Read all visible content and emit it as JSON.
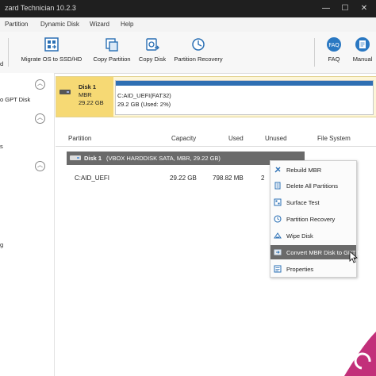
{
  "window": {
    "title": "zard Technician 10.2.3",
    "min": "—",
    "max": "☐",
    "close": "✕"
  },
  "menu": {
    "items": [
      "Partition",
      "Dynamic Disk",
      "Wizard",
      "Help"
    ]
  },
  "toolbar": {
    "items": [
      {
        "label": "Migrate OS to SSD/HD",
        "icon": "migrate-os-icon"
      },
      {
        "label": "Copy Partition",
        "icon": "copy-partition-icon"
      },
      {
        "label": "Copy Disk",
        "icon": "copy-disk-icon"
      },
      {
        "label": "Partition Recovery",
        "icon": "partition-recovery-icon"
      },
      {
        "label": "FAQ",
        "icon": "faq-icon"
      },
      {
        "label": "Manual",
        "icon": "manual-icon"
      }
    ],
    "left_fragment": "d"
  },
  "sidebar": {
    "item_fragment": "o GPT Disk",
    "s_fragment": "s",
    "g_fragment": "g"
  },
  "disk_map": {
    "name": "Disk 1",
    "type": "MBR",
    "size": "29.22 GB",
    "partition_label": "C:AID_UEFI(FAT32)",
    "partition_detail": "29.2 GB (Used: 2%)",
    "used_percent": 2
  },
  "table": {
    "headers": [
      "Partition",
      "Capacity",
      "Used",
      "Unused",
      "File System"
    ],
    "disk_row_name": "Disk 1",
    "disk_row_desc": "(VBOX HARDDISK SATA, MBR, 29.22 GB)",
    "rows": [
      {
        "partition": "C:AID_UEFI",
        "capacity": "29.22 GB",
        "used": "798.82 MB",
        "unused": "2"
      }
    ]
  },
  "context_menu": {
    "items": [
      {
        "label": "Rebuild MBR",
        "icon": "rebuild-mbr-icon"
      },
      {
        "label": "Delete All Partitions",
        "icon": "delete-partitions-icon"
      },
      {
        "label": "Surface Test",
        "icon": "surface-test-icon"
      },
      {
        "label": "Partition Recovery",
        "icon": "partition-recovery-icon"
      },
      {
        "label": "Wipe Disk",
        "icon": "wipe-disk-icon"
      },
      {
        "label": "Convert MBR Disk to GPT Disk",
        "icon": "convert-disk-icon"
      },
      {
        "label": "Properties",
        "icon": "properties-icon"
      }
    ],
    "highlighted_index": 5
  },
  "colors": {
    "accent_blue": "#2f6fb3",
    "disk_yellow": "#f6d974",
    "highlight_gray": "#6a6a6a",
    "faq_blue": "#2a78c2"
  }
}
